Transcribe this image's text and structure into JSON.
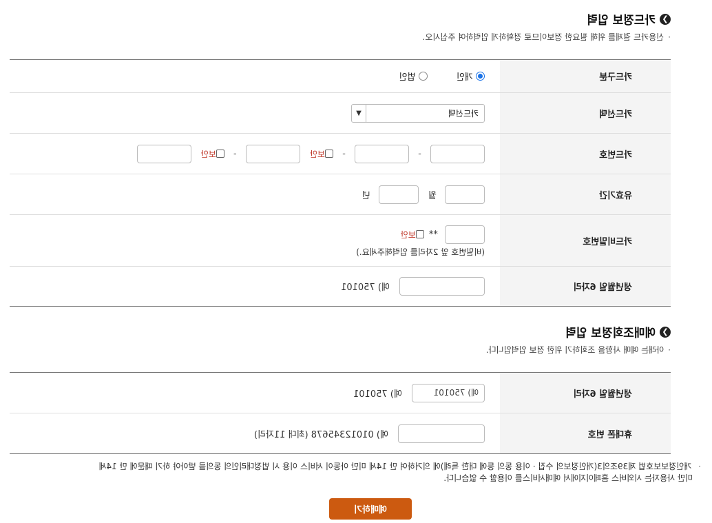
{
  "card_section": {
    "title": "카드정보 입력",
    "note": "신용카드 결제를 위해 필요한 정보이므로 정확하게 입력하여 주십시오.",
    "card_type": {
      "label": "카드구분",
      "options": [
        "개인",
        "법인"
      ],
      "selected": "개인"
    },
    "card_select": {
      "label": "카드선택",
      "value": "카드선택"
    },
    "card_number": {
      "label": "카드번호",
      "separator": "-",
      "secure_label": "보안"
    },
    "expiry": {
      "label": "유효기간",
      "month_suffix": "월",
      "year_suffix": "년"
    },
    "card_password": {
      "label": "카드비밀번호",
      "mask": "**",
      "secure_label": "보안",
      "hint": "(비밀번호 앞 2자리를 입력해주세요.)"
    },
    "birthdate": {
      "label": "생년월일 6자리",
      "example": "예) 750101"
    }
  },
  "reservation_section": {
    "title": "예매조회정보 입력",
    "note": "아래는 예매 사항을 조회하기 위한 정보 입력입니다.",
    "birthdate": {
      "label": "생년월일 6자리",
      "placeholder": "예) 750101",
      "example": "예) 750101"
    },
    "phone": {
      "label": "휴대폰 번호",
      "example": "예) 01012345678 (최대 11자리)"
    }
  },
  "consent": {
    "line1": "개인정보보호법 제39조의3(개인정보의 수집 · 이용 동의 등에 대한 특례)에 의거하여 만 14세 미만 아동이 서비스 이용 시 법정대리인의 동의를 받아야 하기 때문에 만 14세",
    "line2": "미만 사용자는 시외버스 홈페이지에서 예매서비스를 이용할 수 없습니다."
  },
  "submit_label": "예매하기"
}
